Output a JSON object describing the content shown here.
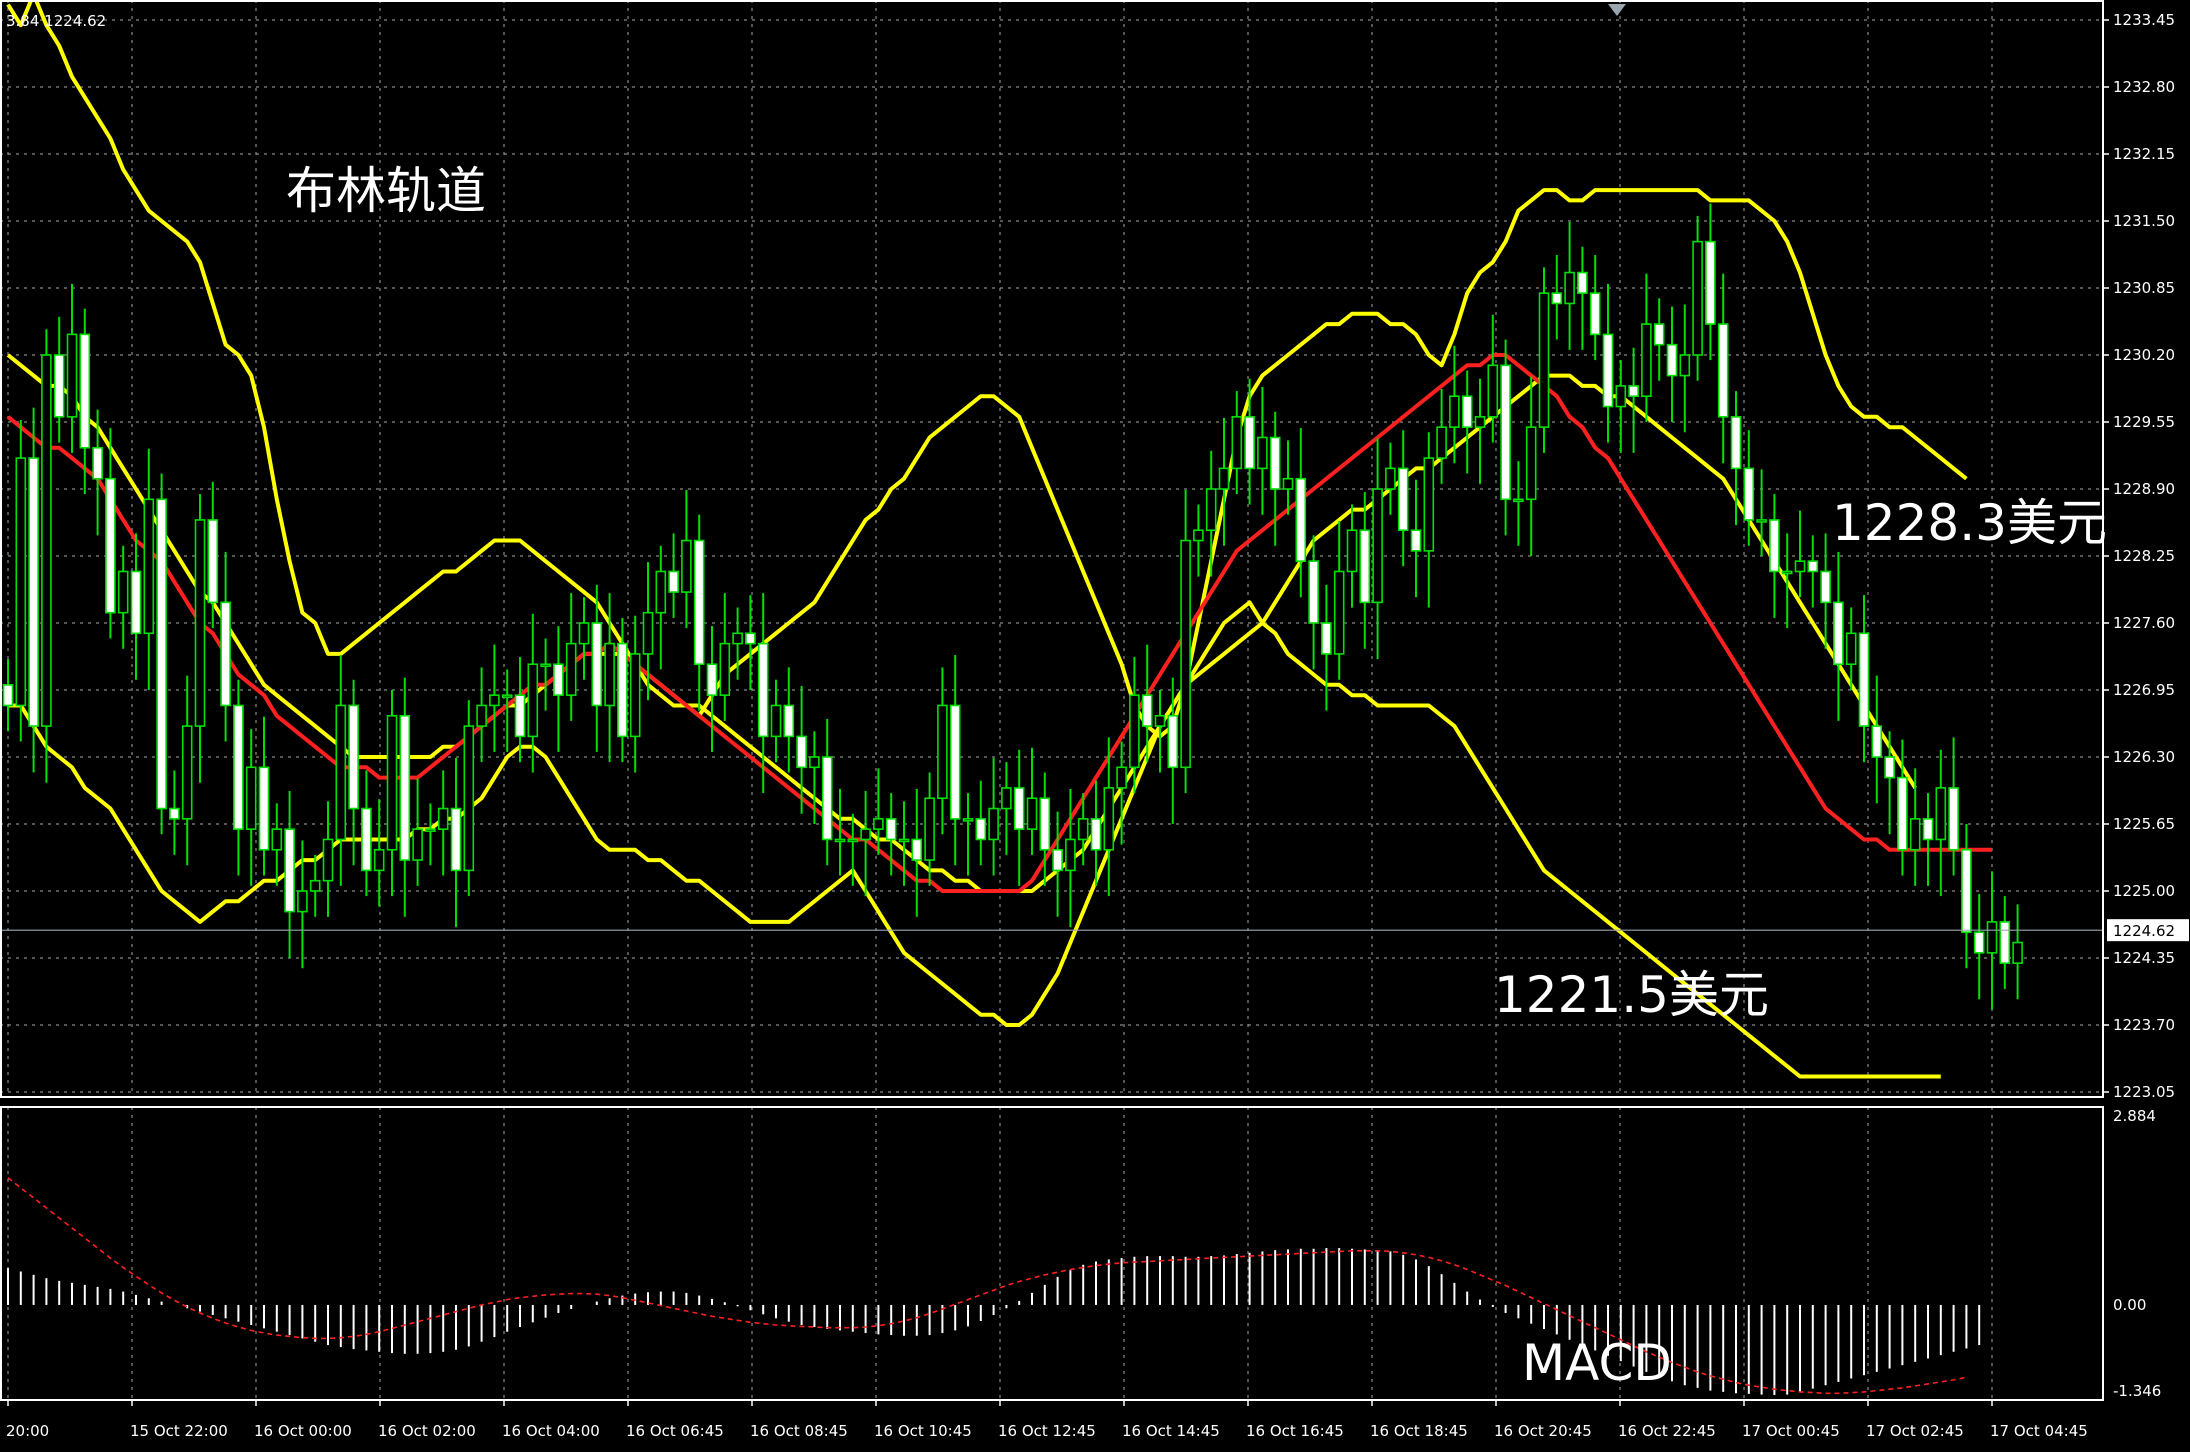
{
  "chart_data": {
    "type": "candlestick",
    "header_text": "3.84 1224.62",
    "annotations": {
      "bollinger": "布林轨道",
      "upper_target": "1228.3美元",
      "lower_target": "1221.5美元",
      "macd": "MACD"
    },
    "price_axis": {
      "ylim": [
        1223.05,
        1233.45
      ],
      "tick_labels": [
        "1233.45",
        "1232.80",
        "1232.15",
        "1231.50",
        "1230.85",
        "1230.20",
        "1229.55",
        "1228.90",
        "1228.25",
        "1227.60",
        "1226.95",
        "1226.30",
        "1225.65",
        "1225.00",
        "1224.35",
        "1223.70",
        "1223.05"
      ],
      "current_price": "1224.62",
      "current_value": 1224.62
    },
    "macd_axis": {
      "ylim": [
        -1.346,
        2.884
      ],
      "tick_labels": [
        "2.884",
        "0.00",
        "-1.346"
      ]
    },
    "time_axis": {
      "labels": [
        "20:00",
        "15 Oct 22:00",
        "16 Oct 00:00",
        "16 Oct 02:00",
        "16 Oct 04:00",
        "16 Oct 06:45",
        "16 Oct 08:45",
        "16 Oct 10:45",
        "16 Oct 12:45",
        "16 Oct 14:45",
        "16 Oct 16:45",
        "16 Oct 18:45",
        "16 Oct 20:45",
        "16 Oct 22:45",
        "17 Oct 00:45",
        "17 Oct 02:45",
        "17 Oct 04:45"
      ],
      "bar_count": 156
    },
    "candles_close": [
      1226.8,
      1229.2,
      1226.6,
      1230.2,
      1229.6,
      1230.4,
      1229.3,
      1229.0,
      1227.7,
      1228.1,
      1227.5,
      1228.8,
      1225.8,
      1225.7,
      1226.6,
      1228.6,
      1227.8,
      1226.8,
      1225.6,
      1226.2,
      1225.4,
      1225.6,
      1224.8,
      1225.0,
      1225.1,
      1225.5,
      1226.8,
      1225.8,
      1225.2,
      1225.4,
      1226.7,
      1225.3,
      1225.6,
      1225.6,
      1225.8,
      1225.2,
      1226.6,
      1226.8,
      1226.9,
      1226.9,
      1226.5,
      1227.2,
      1227.2,
      1226.9,
      1227.4,
      1227.6,
      1226.8,
      1227.4,
      1226.5,
      1227.3,
      1227.7,
      1228.1,
      1227.9,
      1228.4,
      1227.2,
      1226.9,
      1227.4,
      1227.5,
      1227.4,
      1226.5,
      1226.8,
      1226.5,
      1226.2,
      1226.3,
      1225.5,
      1225.5,
      1225.5,
      1225.6,
      1225.7,
      1225.5,
      1225.5,
      1225.3,
      1225.9,
      1226.8,
      1225.7,
      1225.7,
      1225.5,
      1225.8,
      1226.0,
      1225.6,
      1225.9,
      1225.4,
      1225.2,
      1225.5,
      1225.7,
      1225.4,
      1226.0,
      1226.2,
      1226.9,
      1226.6,
      1226.7,
      1226.2,
      1228.4,
      1228.5,
      1228.9,
      1229.1,
      1229.6,
      1229.1,
      1229.4,
      1228.9,
      1229.0,
      1228.2,
      1227.6,
      1227.3,
      1228.1,
      1228.5,
      1227.8,
      1228.9,
      1229.1,
      1228.5,
      1228.3,
      1229.2,
      1229.5,
      1229.8,
      1229.5,
      1229.6,
      1230.1,
      1228.8,
      1228.8,
      1229.5,
      1230.8,
      1230.7,
      1231.0,
      1230.8,
      1230.4,
      1229.7,
      1229.9,
      1229.8,
      1230.5,
      1230.3,
      1230.0,
      1230.2,
      1231.3,
      1230.5,
      1229.6,
      1229.1,
      1228.6,
      1228.6,
      1228.1,
      1228.1,
      1228.2,
      1228.1,
      1227.8,
      1227.2,
      1227.5,
      1226.6,
      1226.3,
      1226.1,
      1225.4,
      1225.7,
      1225.5,
      1226.0,
      1225.4,
      1224.6,
      1224.4,
      1224.7,
      1224.3,
      1224.5
    ],
    "series": [
      {
        "name": "upper",
        "color": "#ffff00",
        "values": [
          1233.6,
          1233.4,
          1233.7,
          1233.4,
          1233.2,
          1232.9,
          1232.7,
          1232.5,
          1232.3,
          1232.0,
          1231.8,
          1231.6,
          1231.5,
          1231.4,
          1231.3,
          1231.1,
          1230.7,
          1230.3,
          1230.2,
          1230.0,
          1229.5,
          1228.8,
          1228.2,
          1227.7,
          1227.6,
          1227.3,
          1227.3,
          1227.4,
          1227.5,
          1227.6,
          1227.7,
          1227.8,
          1227.9,
          1228.0,
          1228.1,
          1228.1,
          1228.2,
          1228.3,
          1228.4,
          1228.4,
          1228.4,
          1228.3,
          1228.2,
          1228.1,
          1228.0,
          1227.9,
          1227.8,
          1227.6,
          1227.4,
          1227.2,
          1227.0,
          1226.9,
          1226.8,
          1226.8,
          1226.7,
          1226.9,
          1227.1,
          1227.2,
          1227.3,
          1227.4,
          1227.5,
          1227.6,
          1227.7,
          1227.8,
          1228.0,
          1228.2,
          1228.4,
          1228.6,
          1228.7,
          1228.9,
          1229.0,
          1229.2,
          1229.4,
          1229.5,
          1229.6,
          1229.7,
          1229.8,
          1229.8,
          1229.7,
          1229.6,
          1229.3,
          1229.0,
          1228.7,
          1228.4,
          1228.1,
          1227.8,
          1227.5,
          1227.2,
          1226.8,
          1226.6,
          1226.5,
          1226.6,
          1227.0,
          1227.6,
          1228.2,
          1228.8,
          1229.4,
          1229.8,
          1230.0,
          1230.1,
          1230.2,
          1230.3,
          1230.4,
          1230.5,
          1230.5,
          1230.6,
          1230.6,
          1230.6,
          1230.5,
          1230.5,
          1230.4,
          1230.2,
          1230.1,
          1230.4,
          1230.8,
          1231.0,
          1231.1,
          1231.3,
          1231.6,
          1231.7,
          1231.8,
          1231.8,
          1231.7,
          1231.7,
          1231.8,
          1231.8,
          1231.8,
          1231.8,
          1231.8,
          1231.8,
          1231.8,
          1231.8,
          1231.8,
          1231.7,
          1231.7,
          1231.7,
          1231.7,
          1231.6,
          1231.5,
          1231.3,
          1231.0,
          1230.6,
          1230.2,
          1229.9,
          1229.7,
          1229.6,
          1229.6,
          1229.5,
          1229.5,
          1229.4,
          1229.3,
          1229.2,
          1229.1,
          1229.0
        ]
      },
      {
        "name": "middle",
        "color": "#ffff00",
        "values": [
          1230.2,
          1230.1,
          1230.0,
          1229.9,
          1229.9,
          1229.8,
          1229.6,
          1229.5,
          1229.3,
          1229.1,
          1228.9,
          1228.7,
          1228.5,
          1228.3,
          1228.1,
          1227.9,
          1227.8,
          1227.6,
          1227.4,
          1227.2,
          1227.0,
          1226.9,
          1226.8,
          1226.7,
          1226.6,
          1226.5,
          1226.4,
          1226.3,
          1226.3,
          1226.3,
          1226.3,
          1226.3,
          1226.3,
          1226.3,
          1226.4,
          1226.4,
          1226.5,
          1226.6,
          1226.7,
          1226.8,
          1226.8,
          1226.9,
          1227.0,
          1227.1,
          1227.2,
          1227.3,
          1227.3,
          1227.3,
          1227.3,
          1227.2,
          1227.1,
          1227.0,
          1226.9,
          1226.8,
          1226.8,
          1226.7,
          1226.6,
          1226.5,
          1226.4,
          1226.3,
          1226.2,
          1226.1,
          1226.0,
          1225.9,
          1225.8,
          1225.7,
          1225.7,
          1225.6,
          1225.5,
          1225.5,
          1225.4,
          1225.3,
          1225.2,
          1225.2,
          1225.1,
          1225.1,
          1225.0,
          1225.0,
          1225.0,
          1225.0,
          1225.0,
          1225.1,
          1225.2,
          1225.3,
          1225.4,
          1225.6,
          1225.8,
          1226.0,
          1226.2,
          1226.4,
          1226.6,
          1226.8,
          1227.0,
          1227.1,
          1227.2,
          1227.3,
          1227.4,
          1227.5,
          1227.6,
          1227.8,
          1228.0,
          1228.2,
          1228.4,
          1228.5,
          1228.6,
          1228.7,
          1228.7,
          1228.8,
          1228.9,
          1229.0,
          1229.1,
          1229.1,
          1229.2,
          1229.3,
          1229.4,
          1229.5,
          1229.6,
          1229.7,
          1229.8,
          1229.9,
          1230.0,
          1230.0,
          1230.0,
          1229.9,
          1229.9,
          1229.8,
          1229.8,
          1229.7,
          1229.6,
          1229.5,
          1229.4,
          1229.3,
          1229.2,
          1229.1,
          1229.0,
          1228.8,
          1228.6,
          1228.4,
          1228.2,
          1228.0,
          1227.8,
          1227.6,
          1227.4,
          1227.2,
          1227.0,
          1226.8,
          1226.6,
          1226.4,
          1226.2,
          1226.0
        ]
      },
      {
        "name": "lower",
        "color": "#ffff00",
        "values": [
          1226.8,
          1226.8,
          1226.6,
          1226.4,
          1226.3,
          1226.2,
          1226.0,
          1225.9,
          1225.8,
          1225.6,
          1225.4,
          1225.2,
          1225.0,
          1224.9,
          1224.8,
          1224.7,
          1224.8,
          1224.9,
          1224.9,
          1225.0,
          1225.1,
          1225.1,
          1225.2,
          1225.3,
          1225.3,
          1225.4,
          1225.5,
          1225.5,
          1225.5,
          1225.5,
          1225.5,
          1225.5,
          1225.6,
          1225.6,
          1225.7,
          1225.7,
          1225.8,
          1225.9,
          1226.1,
          1226.3,
          1226.4,
          1226.4,
          1226.3,
          1226.1,
          1225.9,
          1225.7,
          1225.5,
          1225.4,
          1225.4,
          1225.4,
          1225.3,
          1225.3,
          1225.2,
          1225.1,
          1225.1,
          1225.0,
          1224.9,
          1224.8,
          1224.7,
          1224.7,
          1224.7,
          1224.7,
          1224.8,
          1224.9,
          1225.0,
          1225.1,
          1225.2,
          1225.0,
          1224.8,
          1224.6,
          1224.4,
          1224.3,
          1224.2,
          1224.1,
          1224.0,
          1223.9,
          1223.8,
          1223.8,
          1223.7,
          1223.7,
          1223.8,
          1224.0,
          1224.2,
          1224.5,
          1224.8,
          1225.1,
          1225.4,
          1225.7,
          1226.0,
          1226.3,
          1226.6,
          1226.8,
          1227.0,
          1227.2,
          1227.4,
          1227.6,
          1227.7,
          1227.8,
          1227.6,
          1227.5,
          1227.3,
          1227.2,
          1227.1,
          1227.0,
          1227.0,
          1226.9,
          1226.9,
          1226.8,
          1226.8,
          1226.8,
          1226.8,
          1226.8,
          1226.7,
          1226.6,
          1226.4,
          1226.2,
          1226.0,
          1225.8,
          1225.6,
          1225.4,
          1225.2,
          1225.1,
          1225.0,
          1224.9,
          1224.8,
          1224.7,
          1224.6,
          1224.5,
          1224.4,
          1224.3,
          1224.2,
          1224.1,
          1224.0,
          1223.9,
          1223.8,
          1223.7,
          1223.6,
          1223.5,
          1223.4,
          1223.3,
          1223.2,
          1223.2,
          1223.2,
          1223.2,
          1223.2,
          1223.2,
          1223.2,
          1223.2,
          1223.2,
          1223.2,
          1223.2,
          1223.2
        ]
      },
      {
        "name": "red",
        "color": "#ff2020",
        "values": [
          1229.6,
          1229.5,
          1229.4,
          1229.3,
          1229.3,
          1229.2,
          1229.1,
          1229.0,
          1228.8,
          1228.6,
          1228.4,
          1228.3,
          1228.2,
          1228.0,
          1227.8,
          1227.6,
          1227.5,
          1227.3,
          1227.1,
          1227.0,
          1226.9,
          1226.7,
          1226.6,
          1226.5,
          1226.4,
          1226.3,
          1226.2,
          1226.2,
          1226.2,
          1226.1,
          1226.1,
          1226.1,
          1226.1,
          1226.2,
          1226.3,
          1226.4,
          1226.5,
          1226.6,
          1226.7,
          1226.8,
          1226.9,
          1227.0,
          1227.0,
          1227.1,
          1227.2,
          1227.3,
          1227.3,
          1227.4,
          1227.3,
          1227.2,
          1227.1,
          1227.0,
          1226.9,
          1226.8,
          1226.7,
          1226.6,
          1226.5,
          1226.4,
          1226.3,
          1226.2,
          1226.1,
          1226.0,
          1225.9,
          1225.8,
          1225.7,
          1225.6,
          1225.5,
          1225.5,
          1225.4,
          1225.3,
          1225.2,
          1225.1,
          1225.1,
          1225.0,
          1225.0,
          1225.0,
          1225.0,
          1225.0,
          1225.0,
          1225.0,
          1225.1,
          1225.3,
          1225.5,
          1225.7,
          1225.9,
          1226.1,
          1226.3,
          1226.5,
          1226.7,
          1226.9,
          1227.1,
          1227.3,
          1227.5,
          1227.7,
          1227.9,
          1228.1,
          1228.3,
          1228.4,
          1228.5,
          1228.6,
          1228.7,
          1228.8,
          1228.9,
          1229.0,
          1229.1,
          1229.2,
          1229.3,
          1229.4,
          1229.5,
          1229.6,
          1229.7,
          1229.8,
          1229.9,
          1230.0,
          1230.1,
          1230.1,
          1230.2,
          1230.2,
          1230.1,
          1230.0,
          1229.9,
          1229.8,
          1229.6,
          1229.5,
          1229.3,
          1229.2,
          1229.0,
          1228.8,
          1228.6,
          1228.4,
          1228.2,
          1228.0,
          1227.8,
          1227.6,
          1227.4,
          1227.2,
          1227.0,
          1226.8,
          1226.6,
          1226.4,
          1226.2,
          1226.0,
          1225.8,
          1225.7,
          1225.6,
          1225.5,
          1225.5,
          1225.4,
          1225.4,
          1225.4,
          1225.4,
          1225.4,
          1225.4,
          1225.4,
          1225.4,
          1225.4
        ]
      }
    ],
    "macd": {
      "histogram": [
        0.55,
        0.5,
        0.45,
        0.4,
        0.36,
        0.33,
        0.3,
        0.27,
        0.24,
        0.2,
        0.15,
        0.1,
        0.05,
        0.0,
        -0.05,
        -0.1,
        -0.15,
        -0.2,
        -0.25,
        -0.3,
        -0.35,
        -0.4,
        -0.45,
        -0.5,
        -0.55,
        -0.6,
        -0.63,
        -0.66,
        -0.68,
        -0.7,
        -0.72,
        -0.73,
        -0.73,
        -0.72,
        -0.7,
        -0.67,
        -0.62,
        -0.55,
        -0.48,
        -0.4,
        -0.33,
        -0.26,
        -0.19,
        -0.12,
        -0.06,
        0.0,
        0.05,
        0.1,
        0.14,
        0.17,
        0.19,
        0.2,
        0.2,
        0.18,
        0.14,
        0.09,
        0.04,
        -0.02,
        -0.08,
        -0.14,
        -0.2,
        -0.25,
        -0.3,
        -0.33,
        -0.36,
        -0.38,
        -0.4,
        -0.42,
        -0.44,
        -0.45,
        -0.46,
        -0.46,
        -0.45,
        -0.42,
        -0.38,
        -0.32,
        -0.24,
        -0.15,
        -0.05,
        0.06,
        0.18,
        0.3,
        0.42,
        0.52,
        0.6,
        0.65,
        0.68,
        0.7,
        0.72,
        0.73,
        0.73,
        0.73,
        0.72,
        0.72,
        0.73,
        0.74,
        0.76,
        0.78,
        0.8,
        0.82,
        0.83,
        0.84,
        0.84,
        0.85,
        0.85,
        0.84,
        0.83,
        0.82,
        0.8,
        0.75,
        0.68,
        0.58,
        0.46,
        0.33,
        0.2,
        0.08,
        -0.03,
        -0.12,
        -0.2,
        -0.28,
        -0.36,
        -0.44,
        -0.52,
        -0.6,
        -0.68,
        -0.76,
        -0.84,
        -0.92,
        -1.0,
        -1.08,
        -1.14,
        -1.2,
        -1.24,
        -1.28,
        -1.3,
        -1.32,
        -1.33,
        -1.34,
        -1.346,
        -1.34,
        -1.3,
        -1.25,
        -1.2,
        -1.15,
        -1.1,
        -1.05,
        -1.0,
        -0.95,
        -0.9,
        -0.85,
        -0.8,
        -0.75,
        -0.7,
        -0.65,
        -0.6
      ],
      "signal": [
        1.9,
        1.75,
        1.6,
        1.45,
        1.3,
        1.15,
        1.0,
        0.85,
        0.7,
        0.56,
        0.43,
        0.3,
        0.18,
        0.07,
        -0.03,
        -0.12,
        -0.2,
        -0.27,
        -0.33,
        -0.38,
        -0.42,
        -0.45,
        -0.47,
        -0.49,
        -0.5,
        -0.5,
        -0.49,
        -0.47,
        -0.44,
        -0.4,
        -0.35,
        -0.3,
        -0.25,
        -0.2,
        -0.15,
        -0.1,
        -0.05,
        0.0,
        0.04,
        0.08,
        0.11,
        0.13,
        0.15,
        0.16,
        0.17,
        0.17,
        0.16,
        0.14,
        0.11,
        0.07,
        0.03,
        -0.01,
        -0.05,
        -0.09,
        -0.13,
        -0.17,
        -0.2,
        -0.23,
        -0.26,
        -0.28,
        -0.3,
        -0.31,
        -0.32,
        -0.33,
        -0.34,
        -0.34,
        -0.34,
        -0.33,
        -0.31,
        -0.28,
        -0.24,
        -0.19,
        -0.13,
        -0.06,
        0.01,
        0.08,
        0.15,
        0.22,
        0.29,
        0.35,
        0.4,
        0.45,
        0.49,
        0.53,
        0.56,
        0.59,
        0.61,
        0.63,
        0.64,
        0.65,
        0.66,
        0.67,
        0.68,
        0.69,
        0.7,
        0.71,
        0.72,
        0.73,
        0.74,
        0.75,
        0.76,
        0.77,
        0.78,
        0.79,
        0.8,
        0.81,
        0.81,
        0.81,
        0.8,
        0.78,
        0.75,
        0.71,
        0.66,
        0.6,
        0.53,
        0.45,
        0.37,
        0.29,
        0.2,
        0.11,
        0.02,
        -0.07,
        -0.16,
        -0.25,
        -0.34,
        -0.43,
        -0.52,
        -0.61,
        -0.7,
        -0.78,
        -0.86,
        -0.93,
        -1.0,
        -1.06,
        -1.11,
        -1.16,
        -1.2,
        -1.23,
        -1.26,
        -1.28,
        -1.3,
        -1.31,
        -1.32,
        -1.32,
        -1.31,
        -1.3,
        -1.28,
        -1.26,
        -1.24,
        -1.21,
        -1.18,
        -1.15,
        -1.12,
        -1.08
      ]
    }
  }
}
